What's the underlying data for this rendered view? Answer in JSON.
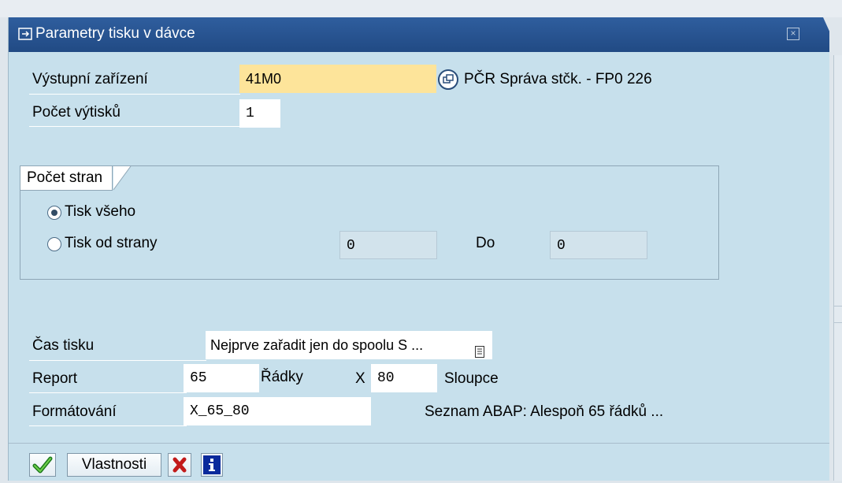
{
  "dialog": {
    "title": "Parametry tisku v dávce",
    "close_glyph": "×"
  },
  "output_device": {
    "label": "Výstupní zařízení",
    "value": "41M0",
    "description": "PČR Správa stčk. - FP0 226"
  },
  "copies": {
    "label": "Počet výtisků",
    "value": "1"
  },
  "pages_group": {
    "title": "Počet stran",
    "print_all_label": "Tisk všeho",
    "print_all_selected": true,
    "print_from_label": "Tisk od strany",
    "print_from_selected": false,
    "from_value": "0",
    "to_label": "Do",
    "to_value": "0"
  },
  "print_time": {
    "label": "Čas tisku",
    "value": "Nejprve zařadit jen do spoolu S ..."
  },
  "report": {
    "label": "Report",
    "rows_value": "65",
    "rows_label": "Řádky",
    "x_label": "X",
    "cols_value": "80",
    "cols_label": "Sloupce"
  },
  "formatting": {
    "label": "Formátování",
    "value": "X_65_80",
    "description": "Seznam ABAP: Alespoň 65 řádků ..."
  },
  "toolbar": {
    "properties_label": "Vlastnosti"
  },
  "icons": {
    "confirm": "check-icon",
    "cancel": "cross-icon",
    "info": "info-icon",
    "help": "possible-entries-icon"
  },
  "colors": {
    "titlebar": "#2f5e9e",
    "required_field": "#fde49a",
    "dialog_bg": "#c7e0ec"
  }
}
